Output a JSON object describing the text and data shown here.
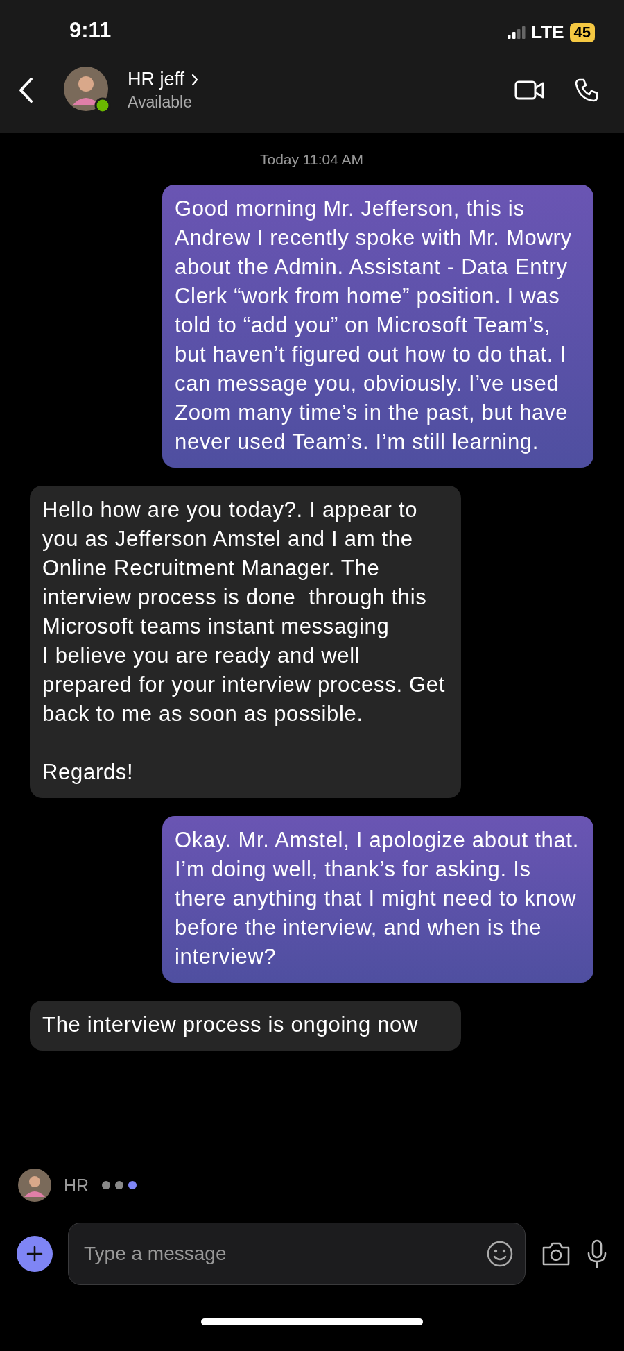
{
  "status_bar": {
    "time": "9:11",
    "network": "LTE",
    "battery": "45"
  },
  "header": {
    "name": "HR jeff",
    "presence": "Available"
  },
  "timestamp": "Today 11:04 AM",
  "messages": [
    {
      "kind": "sent",
      "text": "Good morning Mr. Jefferson, this is Andrew I recently spoke with Mr. Mowry about the Admin. Assistant - Data Entry Clerk “work from home” position. I was told to “add you” on Microsoft Team’s, but haven’t figured out how to do that. I can message you, obviously. I’ve used Zoom many time’s in the past, but have never used Team’s. I’m still learning."
    },
    {
      "kind": "received",
      "text": "Hello how are you today?. I appear to you as Jefferson Amstel and I am the Online Recruitment Manager. The interview process is done  through this Microsoft teams instant messaging\nI believe you are ready and well prepared for your interview process. Get back to me as soon as possible.\n\nRegards!"
    },
    {
      "kind": "sent",
      "text": "Okay. Mr. Amstel, I apologize about that. I’m doing well, thank’s for asking. Is there anything that I might need to know before the interview, and when is the interview?"
    },
    {
      "kind": "received",
      "text": "The interview process is ongoing now"
    }
  ],
  "typing": {
    "name": "HR"
  },
  "composer": {
    "placeholder": "Type a message"
  }
}
